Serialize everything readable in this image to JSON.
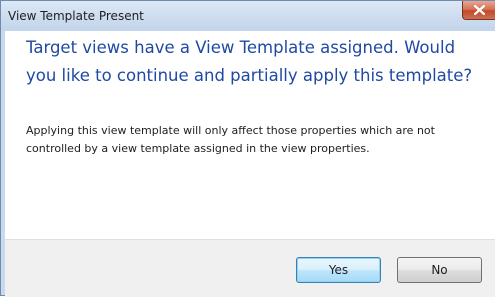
{
  "window": {
    "title": "View Template Present"
  },
  "message": {
    "main_instruction": "Target views have a View Template assigned. Would you like to continue and partially apply this template?",
    "detail": "Applying this view template will only affect those properties which are not controlled by a view template assigned in the view properties."
  },
  "buttons": {
    "yes_label": "Yes",
    "no_label": "No"
  },
  "icons": {
    "close": "close-icon"
  },
  "colors": {
    "main_instruction_text": "#1f49a4",
    "close_button": "#c14a2c",
    "default_button_border": "#3c7fb1"
  }
}
